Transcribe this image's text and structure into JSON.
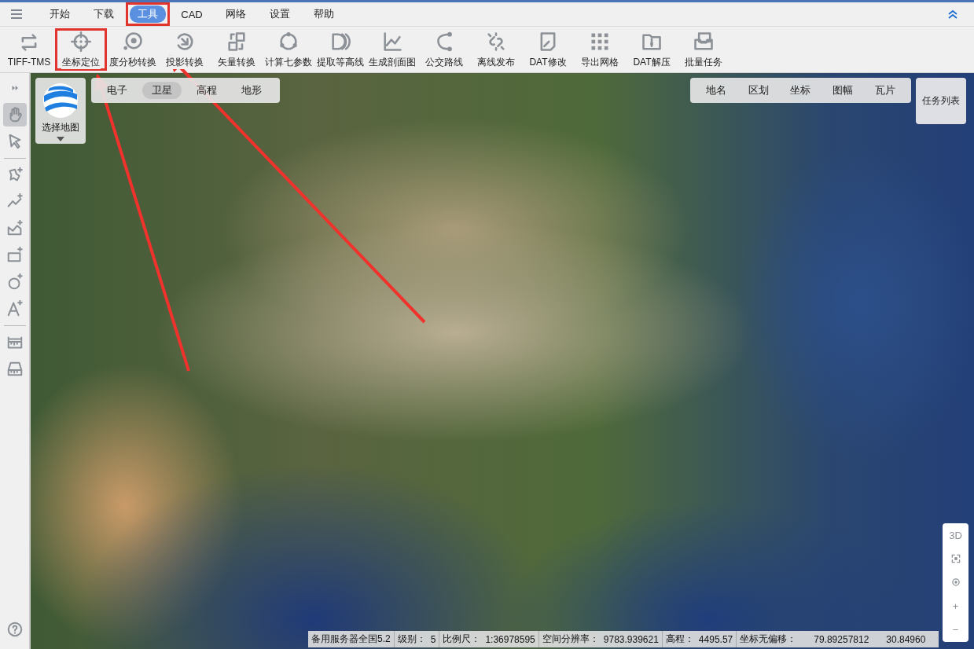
{
  "menu": {
    "items": [
      {
        "label": "开始",
        "selected": false,
        "highlighted": false
      },
      {
        "label": "下载",
        "selected": false,
        "highlighted": false
      },
      {
        "label": "工具",
        "selected": true,
        "highlighted": true
      },
      {
        "label": "CAD",
        "selected": false,
        "highlighted": false
      },
      {
        "label": "网络",
        "selected": false,
        "highlighted": false
      },
      {
        "label": "设置",
        "selected": false,
        "highlighted": false
      },
      {
        "label": "帮助",
        "selected": false,
        "highlighted": false
      }
    ]
  },
  "toolbar": {
    "items": [
      {
        "label": "TIFF-TMS",
        "kind": "swap",
        "highlighted": false
      },
      {
        "label": "坐标定位",
        "kind": "crosshair",
        "highlighted": true
      },
      {
        "label": "度分秒转换",
        "kind": "target",
        "highlighted": false
      },
      {
        "label": "投影转换",
        "kind": "rotate",
        "highlighted": false
      },
      {
        "label": "矢量转换",
        "kind": "squares",
        "highlighted": false
      },
      {
        "label": "计算七参数",
        "kind": "ring",
        "highlighted": false
      },
      {
        "label": "提取等高线",
        "kind": "contour",
        "highlighted": false
      },
      {
        "label": "生成剖面图",
        "kind": "profile",
        "highlighted": false
      },
      {
        "label": "公交路线",
        "kind": "route",
        "highlighted": false
      },
      {
        "label": "离线发布",
        "kind": "broken-link",
        "highlighted": false
      },
      {
        "label": "DAT修改",
        "kind": "doc-edit",
        "highlighted": false
      },
      {
        "label": "导出网格",
        "kind": "grid",
        "highlighted": false
      },
      {
        "label": "DAT解压",
        "kind": "folder-zip",
        "highlighted": false
      },
      {
        "label": "批量任务",
        "kind": "tray",
        "highlighted": false
      }
    ]
  },
  "sidebar": {
    "tools": [
      {
        "kind": "expand"
      },
      {
        "kind": "hand",
        "selected": true
      },
      {
        "kind": "pointer",
        "selected": false
      },
      {
        "kind": "separator"
      },
      {
        "kind": "shape",
        "selected": false
      },
      {
        "kind": "polyline",
        "selected": false
      },
      {
        "kind": "area",
        "selected": false
      },
      {
        "kind": "rectangle",
        "selected": false
      },
      {
        "kind": "circle",
        "selected": false
      },
      {
        "kind": "text",
        "selected": false
      },
      {
        "kind": "separator"
      },
      {
        "kind": "ruler",
        "selected": false
      },
      {
        "kind": "measure",
        "selected": false
      }
    ],
    "help": {
      "kind": "help"
    }
  },
  "map": {
    "map_picker": {
      "label": "选择地图"
    },
    "layers": [
      {
        "label": "电子",
        "selected": false
      },
      {
        "label": "卫星",
        "selected": true
      },
      {
        "label": "高程",
        "selected": false
      },
      {
        "label": "地形",
        "selected": false
      }
    ],
    "overlays": [
      {
        "label": "地名"
      },
      {
        "label": "区划"
      },
      {
        "label": "坐标"
      },
      {
        "label": "图幅"
      },
      {
        "label": "瓦片"
      }
    ],
    "task_list": {
      "label": "任务列表"
    },
    "controls": [
      {
        "kind": "text",
        "label": "3D"
      },
      {
        "kind": "fit"
      },
      {
        "kind": "locate"
      },
      {
        "kind": "text",
        "label": "+"
      },
      {
        "kind": "text",
        "label": "−"
      }
    ]
  },
  "status_bar": {
    "items": [
      {
        "texts": [
          "备用服务器全国5.2"
        ]
      },
      {
        "texts": [
          "级别：",
          "5"
        ]
      },
      {
        "texts": [
          "比例尺：",
          "1:36978595"
        ]
      },
      {
        "texts": [
          "空间分辨率：",
          "9783.939621"
        ]
      },
      {
        "texts": [
          "高程：",
          "4495.57"
        ]
      },
      {
        "texts": [
          "坐标无偏移：",
          "79.89257812",
          "30.84960"
        ]
      }
    ]
  }
}
